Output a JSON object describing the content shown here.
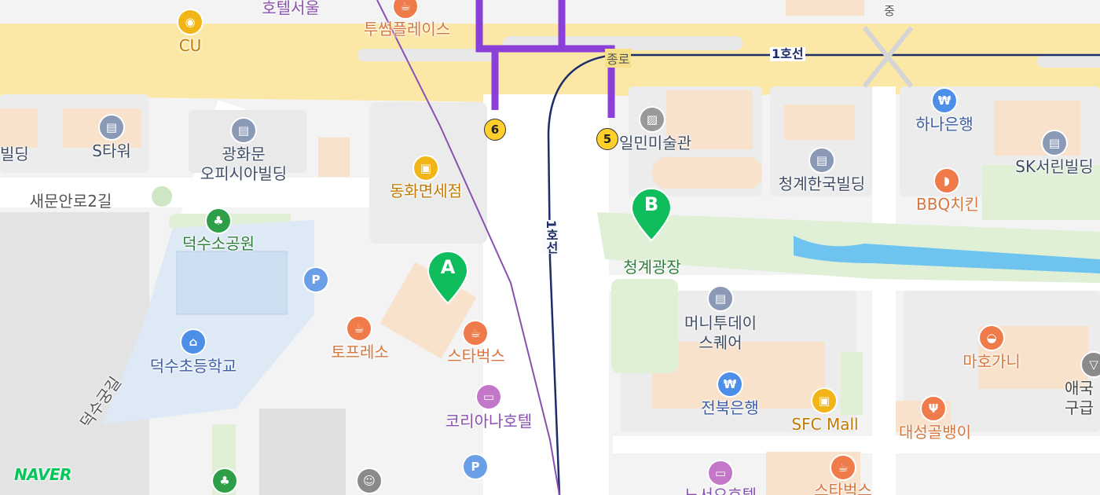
{
  "map": {
    "provider_logo": "NAVER",
    "markers": [
      {
        "id": "A",
        "label": "A",
        "color": "#0fbd5c"
      },
      {
        "id": "B",
        "label": "B",
        "color": "#0fbd5c"
      }
    ],
    "subway": {
      "station": "종로",
      "line_label": "1호선",
      "line_color": "#1c2d6b",
      "exit_6": "6",
      "exit_5": "5"
    },
    "labels": {
      "cu": "CU",
      "hotel_seoul": "호텔서울",
      "twosome": "투썸플레이스",
      "building_left": "빌딩",
      "s_tower": "S타워",
      "gwanghwamun": "광화문\n오피시아빌딩",
      "dongwha": "동화면세점",
      "ilmin": "일민미술관",
      "hana": "하나은행",
      "sk_seorin": "SK서린빌딩",
      "cheonggye_hanguk": "청계한국빌딩",
      "bbq": "BBQ치킨",
      "saemunan": "새문안로2길",
      "deoksuso": "덕수소공원",
      "cheonggye_plaza": "청계광장",
      "toprese": "토프레소",
      "starbucks": "스타벅스",
      "koreana": "코리아나호텔",
      "deoksu_elem": "덕수초등학교",
      "deoksugung_gil": "덕수궁길",
      "money_today": "머니투데이\n스퀘어",
      "jeonbuk": "전북은행",
      "sfc": "SFC Mall",
      "mahogany": "마호가니",
      "daeseong": "대성골뱅이",
      "aegukga": "애국\n구급",
      "jung": "중",
      "starbucks2": "스타벅스",
      "hotel_bottom": "노서오호텔"
    }
  },
  "colors": {
    "main_road": "#fbe8a6",
    "park": "#dff0d6",
    "water": "#6fc3ef",
    "building": "#f8e2cc",
    "line1": "#1c2d6b",
    "line5": "#8b3fd9",
    "marker": "#0fbd5c"
  }
}
